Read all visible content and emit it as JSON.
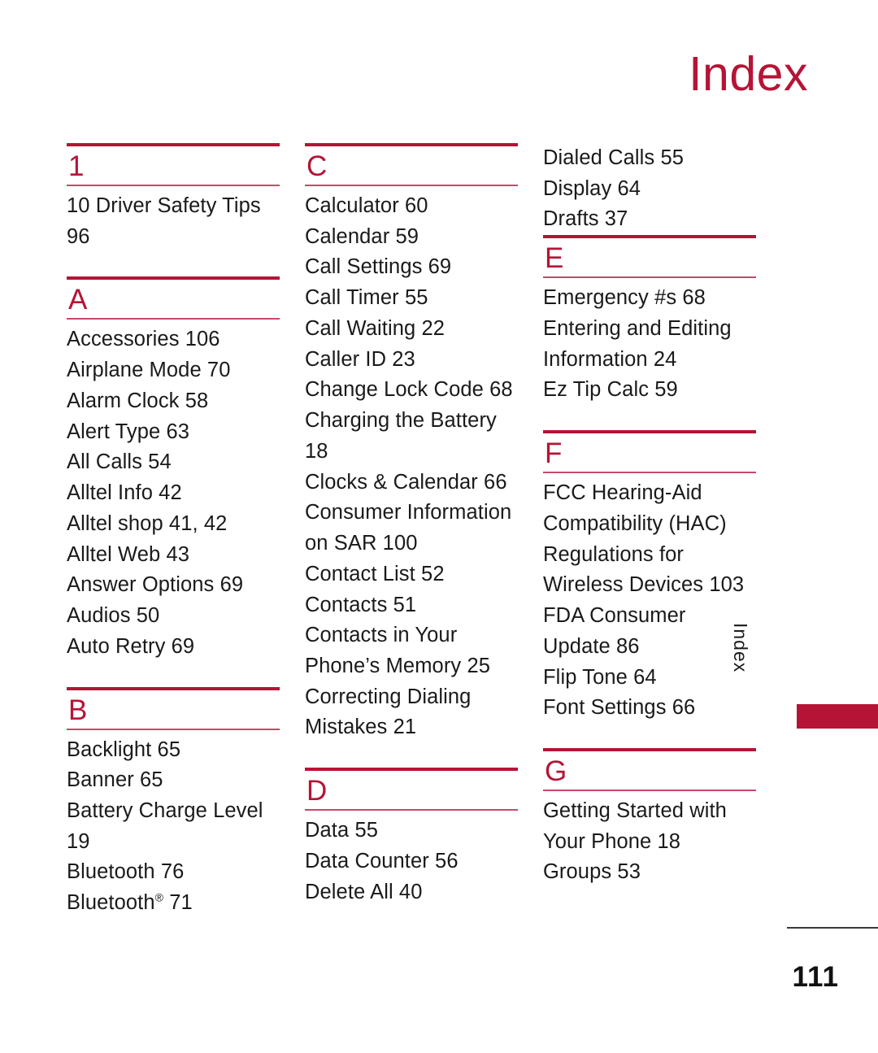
{
  "header": {
    "title": "Index"
  },
  "side_tab": {
    "label": "Index"
  },
  "footer": {
    "page_number": "111"
  },
  "colors": {
    "accent_red": "#b51436",
    "rule_thin": "#c9486a",
    "text": "#1a1a1a",
    "footer_rule": "#3a3a3a"
  },
  "columns": [
    {
      "sections": [
        {
          "letter": "1",
          "entries": [
            "10 Driver Safety Tips 96"
          ]
        },
        {
          "letter": "A",
          "entries": [
            "Accessories 106",
            "Airplane Mode 70",
            "Alarm Clock 58",
            "Alert Type 63",
            "All Calls 54",
            "Alltel Info 42",
            "Alltel shop 41, 42",
            "Alltel Web 43",
            "Answer Options 69",
            "Audios 50",
            "Auto Retry 69"
          ]
        },
        {
          "letter": "B",
          "entries": [
            "Backlight 65",
            "Banner 65",
            "Battery Charge Level 19",
            "Bluetooth 76",
            "Bluetooth® 71"
          ]
        }
      ]
    },
    {
      "sections": [
        {
          "letter": "C",
          "entries": [
            "Calculator 60",
            "Calendar 59",
            "Call Settings 69",
            "Call Timer 55",
            "Call Waiting 22",
            "Caller ID 23",
            "Change Lock Code 68",
            "Charging the Battery 18",
            "Clocks & Calendar 66",
            "Consumer Information on SAR 100",
            "Contact List 52",
            "Contacts 51",
            "Contacts in Your Phone’s Memory 25",
            "Correcting Dialing Mistakes 21"
          ]
        },
        {
          "letter": "D",
          "entries": [
            "Data 55",
            "Data Counter 56",
            "Delete All 40"
          ]
        }
      ]
    },
    {
      "continuation": [
        "Dialed Calls 55",
        "Display 64",
        "Drafts 37"
      ],
      "sections": [
        {
          "letter": "E",
          "entries": [
            "Emergency #s 68",
            "Entering and Editing Information 24",
            "Ez Tip Calc 59"
          ]
        },
        {
          "letter": "F",
          "entries": [
            "FCC Hearing-Aid Compatibility (HAC) Regulations for Wireless Devices 103",
            "FDA Consumer Update 86",
            "Flip Tone 64",
            "Font Settings 66"
          ]
        },
        {
          "letter": "G",
          "entries": [
            "Getting Started with Your Phone 18",
            "Groups 53"
          ]
        }
      ]
    }
  ]
}
